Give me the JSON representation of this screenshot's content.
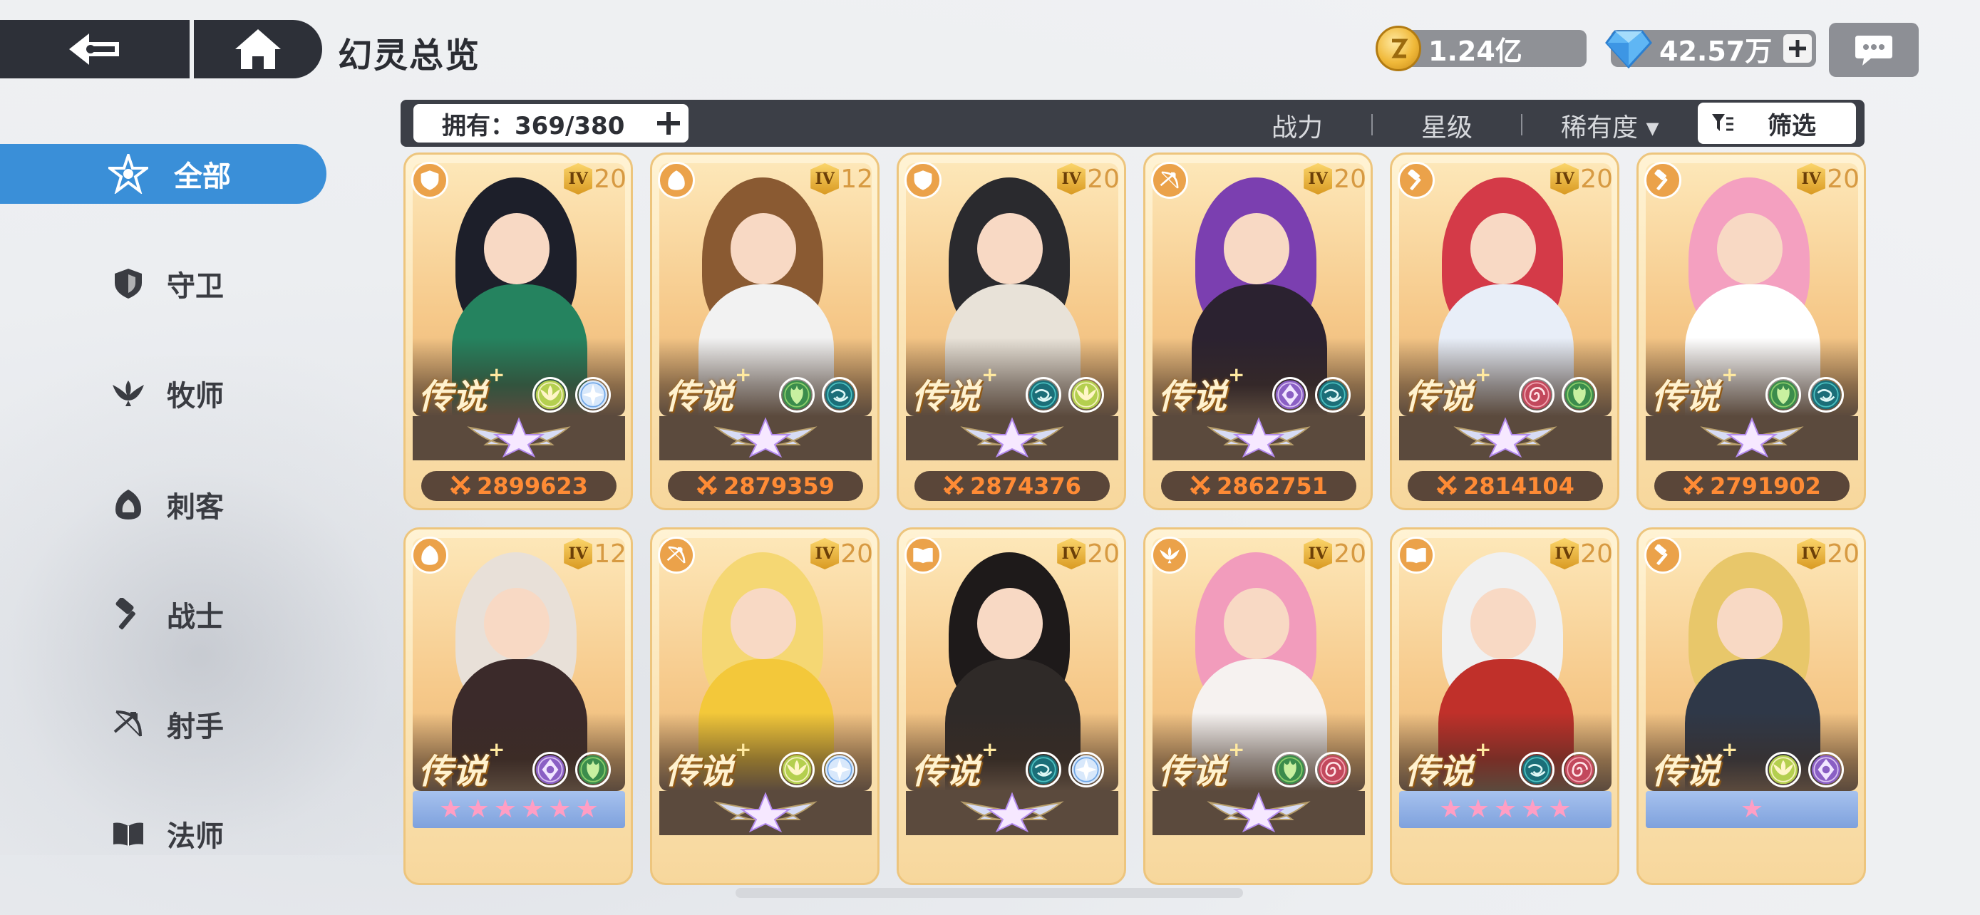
{
  "header": {
    "title": "幻灵总览",
    "gold": {
      "value": "1.24亿",
      "icon": "gold-coin-icon"
    },
    "gems": {
      "value": "42.57万",
      "icon": "diamond-icon"
    },
    "chat_icon": "chat-bubble-icon"
  },
  "sidebar": {
    "items": [
      {
        "label": "全部",
        "icon": "all-star-icon",
        "active": true
      },
      {
        "label": "守卫",
        "icon": "shield-icon",
        "active": false
      },
      {
        "label": "牧师",
        "icon": "wings-icon",
        "active": false
      },
      {
        "label": "刺客",
        "icon": "hood-icon",
        "active": false
      },
      {
        "label": "战士",
        "icon": "hammer-icon",
        "active": false
      },
      {
        "label": "射手",
        "icon": "bow-icon",
        "active": false
      },
      {
        "label": "法师",
        "icon": "book-icon",
        "active": false
      }
    ]
  },
  "filter_bar": {
    "owned": "拥有：369/380",
    "sort_tabs": [
      "战力",
      "星级",
      "稀有度 ▾"
    ],
    "filter_label": "筛选"
  },
  "colors": {
    "accent": "#3a8fd8",
    "power": "#ff8b35",
    "card_border": "#edc57d"
  },
  "cards": [
    {
      "role": "shield-icon",
      "tier": "IV",
      "level": "20",
      "rarity": "传说",
      "elements": [
        "wings-element-icon",
        "frost-element-icon"
      ],
      "rank": "wings-rank-icon",
      "stars": 0,
      "power": "2899623"
    },
    {
      "role": "hood-icon",
      "tier": "IV",
      "level": "12",
      "rarity": "传说",
      "elements": [
        "leaf-element-icon",
        "wind-element-icon"
      ],
      "rank": "wings-rank-icon",
      "stars": 0,
      "power": "2879359"
    },
    {
      "role": "shield-icon",
      "tier": "IV",
      "level": "20",
      "rarity": "传说",
      "elements": [
        "wind-element-icon",
        "wings-element-icon"
      ],
      "rank": "wings-rank-icon",
      "stars": 0,
      "power": "2874376"
    },
    {
      "role": "bow-icon",
      "tier": "IV",
      "level": "20",
      "rarity": "传说",
      "elements": [
        "void-element-icon",
        "wind-element-icon"
      ],
      "rank": "wings-rank-icon",
      "stars": 0,
      "power": "2862751"
    },
    {
      "role": "hammer-icon",
      "tier": "IV",
      "level": "20",
      "rarity": "传说",
      "elements": [
        "spiral-element-icon",
        "leaf-element-icon"
      ],
      "rank": "wings-rank-icon",
      "stars": 0,
      "power": "2814104"
    },
    {
      "role": "hammer-icon",
      "tier": "IV",
      "level": "20",
      "rarity": "传说",
      "elements": [
        "leaf-element-icon",
        "wind-element-icon"
      ],
      "rank": "wings-rank-icon",
      "stars": 0,
      "power": "2791902"
    },
    {
      "role": "hood-icon",
      "tier": "IV",
      "level": "12",
      "rarity": "传说",
      "elements": [
        "void-element-icon",
        "leaf-element-icon"
      ],
      "rank": "star-band",
      "stars": 6,
      "power": ""
    },
    {
      "role": "bow-icon",
      "tier": "IV",
      "level": "20",
      "rarity": "传说",
      "elements": [
        "wings-element-icon",
        "frost-element-icon"
      ],
      "rank": "wings-rank-icon",
      "stars": 0,
      "power": ""
    },
    {
      "role": "book-icon",
      "tier": "IV",
      "level": "20",
      "rarity": "传说",
      "elements": [
        "wind-element-icon",
        "frost-element-icon"
      ],
      "rank": "wings-rank-icon",
      "stars": 0,
      "power": ""
    },
    {
      "role": "wings-icon",
      "tier": "IV",
      "level": "20",
      "rarity": "传说",
      "elements": [
        "leaf-element-icon",
        "spiral-element-icon"
      ],
      "rank": "wings-rank-icon",
      "stars": 0,
      "power": ""
    },
    {
      "role": "book-icon",
      "tier": "IV",
      "level": "20",
      "rarity": "传说",
      "elements": [
        "wind-element-icon",
        "spiral-element-icon"
      ],
      "rank": "star-band",
      "stars": 5,
      "power": ""
    },
    {
      "role": "hammer-icon",
      "tier": "IV",
      "level": "20",
      "rarity": "传说",
      "elements": [
        "wings-element-icon",
        "void-element-icon"
      ],
      "rank": "star-band",
      "stars": 1,
      "power": ""
    }
  ]
}
